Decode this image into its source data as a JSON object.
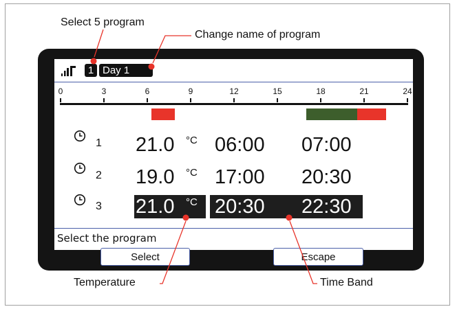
{
  "callouts": {
    "select_program": "Select 5 program",
    "change_name": "Change name of program",
    "temperature": "Temperature",
    "time_band": "Time Band"
  },
  "header": {
    "program_number": "1",
    "program_name": "Day 1"
  },
  "timeline": {
    "ticks": [
      "0",
      "3",
      "6",
      "9",
      "12",
      "15",
      "18",
      "21",
      "24"
    ],
    "bands": [
      {
        "start": 6.3,
        "end": 7.9,
        "color": "#e8342a"
      },
      {
        "start": 17.0,
        "end": 20.5,
        "color": "#3d5e2c"
      },
      {
        "start": 20.5,
        "end": 22.5,
        "color": "#e8342a"
      }
    ]
  },
  "programs": [
    {
      "index": "1",
      "temperature": "21.0",
      "unit": "°C",
      "start": "06:00",
      "end": "07:00"
    },
    {
      "index": "2",
      "temperature": "19.0",
      "unit": "°C",
      "start": "17:00",
      "end": "20:30"
    },
    {
      "index": "3",
      "temperature": "21.0",
      "unit": "°C",
      "start": "20:30",
      "end": "22:30"
    }
  ],
  "status": "Select the program",
  "softkeys": {
    "select": "Select",
    "escape": "Escape"
  },
  "colors": {
    "band_red": "#e8342a",
    "band_green": "#3d5e2c",
    "callout_line": "#e8342a",
    "device": "#141414"
  }
}
